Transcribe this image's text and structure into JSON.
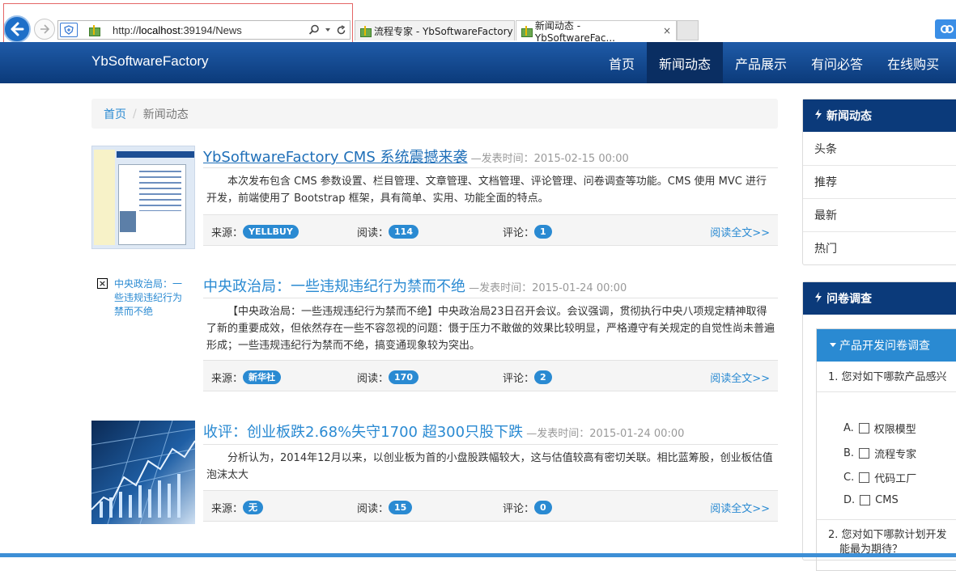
{
  "browser": {
    "url_prefix": "http://",
    "url_host": "localhost",
    "url_rest": ":39194/News",
    "tabs": [
      {
        "title": "流程专家 - YbSoftwareFactory"
      },
      {
        "title": "新闻动态 - YbSoftwareFac..."
      }
    ],
    "close_glyph": "×"
  },
  "site": {
    "brand": "YbSoftwareFactory",
    "nav": [
      "首页",
      "新闻动态",
      "产品展示",
      "有问必答",
      "在线购买"
    ]
  },
  "breadcrumb": {
    "home": "首页",
    "sep": "/",
    "current": "新闻动态"
  },
  "news": [
    {
      "title": "YbSoftwareFactory CMS 系统震撼来袭",
      "time": "—发表时间：2015-02-15 00:00",
      "summary": "本次发布包含 CMS 参数设置、栏目管理、文章管理、文档管理、评论管理、问卷调查等功能。CMS 使用 MVC 进行开发，前端使用了 Bootstrap 框架，具有简单、实用、功能全面的特点。",
      "source_label": "来源：",
      "source": "YELLBUY",
      "read_label": "阅读：",
      "reads": "114",
      "comment_label": "评论：",
      "comments": "1",
      "more": "阅读全文>>"
    },
    {
      "title": "中央政治局：一些违规违纪行为禁而不绝",
      "time": "—发表时间：2015-01-24 00:00",
      "image_alt": "中央政治局：一些违规违纪行为禁而不绝",
      "summary": "【中央政治局：一些违规违纪行为禁而不绝】中央政治局23日召开会议。会议强调，贯彻执行中央八项规定精神取得了新的重要成效，但依然存在一些不容忽视的问题：慑于压力不敢做的效果比较明显，严格遵守有关规定的自觉性尚未普遍形成；一些违规违纪行为禁而不绝，搞变通现象较为突出。",
      "source_label": "来源：",
      "source": "新华社",
      "read_label": "阅读：",
      "reads": "170",
      "comment_label": "评论：",
      "comments": "2",
      "more": "阅读全文>>"
    },
    {
      "title": "收评：创业板跌2.68%失守1700 超300只股下跌",
      "time": "—发表时间：2015-01-24 00:00",
      "summary": "分析认为，2014年12月以来，以创业板为首的小盘股跌幅较大，这与估值较高有密切关联。相比蓝筹股，创业板估值泡沫太大",
      "source_label": "来源：",
      "source": "无",
      "read_label": "阅读：",
      "reads": "15",
      "comment_label": "评论：",
      "comments": "0",
      "more": "阅读全文>>"
    }
  ],
  "sidebar": {
    "news_panel": {
      "title": "新闻动态",
      "items": [
        "头条",
        "推荐",
        "最新",
        "热门"
      ]
    },
    "survey_panel": {
      "title": "问卷调查",
      "survey_title": "产品开发问卷调查",
      "q1": "1.  您对如下哪款产品感兴",
      "options": [
        {
          "letter": "A.",
          "label": "权限模型"
        },
        {
          "letter": "B.",
          "label": "流程专家"
        },
        {
          "letter": "C.",
          "label": "代码工厂"
        },
        {
          "letter": "D.",
          "label": "CMS"
        }
      ],
      "q2": "2.  您对如下哪款计划开发",
      "q2_cont": "能最为期待？"
    }
  },
  "colors": {
    "nav": "#0b3a7a",
    "accent": "#2a8ad2"
  }
}
